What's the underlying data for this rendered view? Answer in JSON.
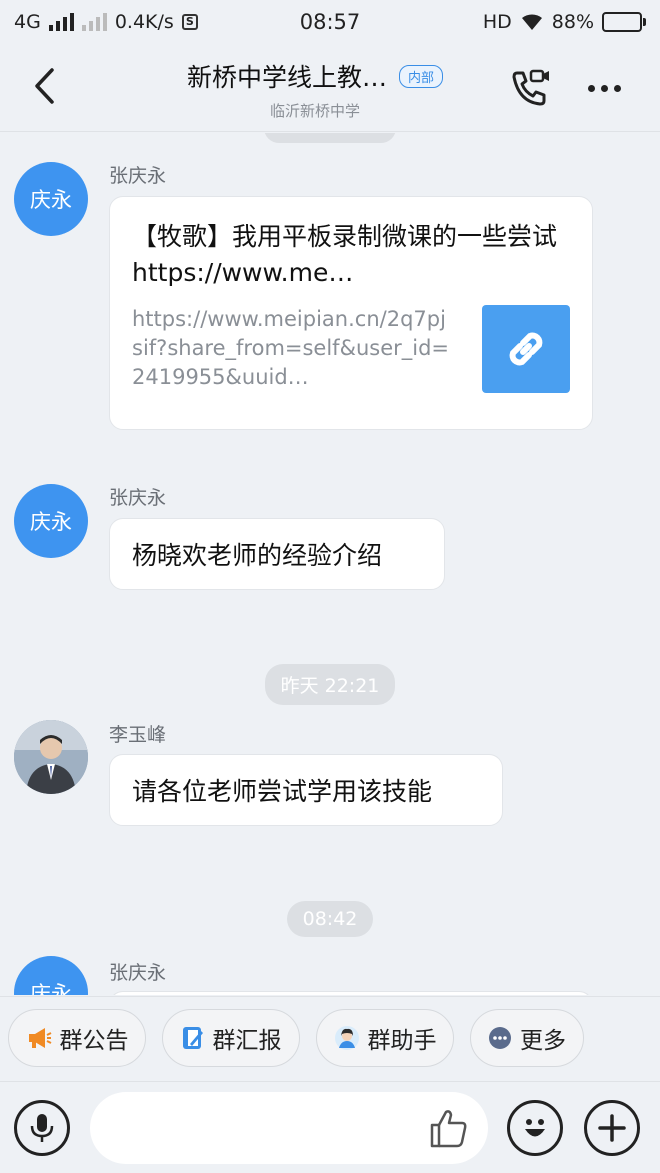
{
  "status": {
    "network": "4G",
    "speed": "0.4K/s",
    "time": "08:57",
    "hd": "HD",
    "battery": "88%",
    "battery_level": 0.88
  },
  "header": {
    "title": "新桥中学线上教…",
    "badge": "内部",
    "subtitle": "临沂新桥中学"
  },
  "messages": [
    {
      "sender": "张庆永",
      "avatar_text": "庆永",
      "type": "link",
      "title": "【牧歌】我用平板录制微课的一些尝试  https://www.me…",
      "url": "https://www.meipian.cn/2q7pjsif?share_from=self&user_id=2419955&uuid…"
    },
    {
      "sender": "张庆永",
      "avatar_text": "庆永",
      "type": "text",
      "text": "杨晓欢老师的经验介绍"
    },
    {
      "timestamp": "昨天 22:21"
    },
    {
      "sender": "李玉峰",
      "avatar_text": "",
      "type": "text",
      "text": "请各位老师尝试学用该技能"
    },
    {
      "timestamp": "08:42"
    },
    {
      "sender": "张庆永",
      "avatar_text": "庆永",
      "type": "text",
      "text": ""
    }
  ],
  "quick_actions": [
    {
      "label": "群公告",
      "icon": "megaphone-icon",
      "color": "#f08a24"
    },
    {
      "label": "群汇报",
      "icon": "report-icon",
      "color": "#3a8ee6"
    },
    {
      "label": "群助手",
      "icon": "assistant-icon",
      "color": "#3a8ee6"
    },
    {
      "label": "更多",
      "icon": "more-dots-icon",
      "color": "#5a6b8c"
    }
  ],
  "composer": {
    "placeholder": ""
  },
  "colors": {
    "accent": "#3e94f0",
    "background": "#eef1f5"
  }
}
